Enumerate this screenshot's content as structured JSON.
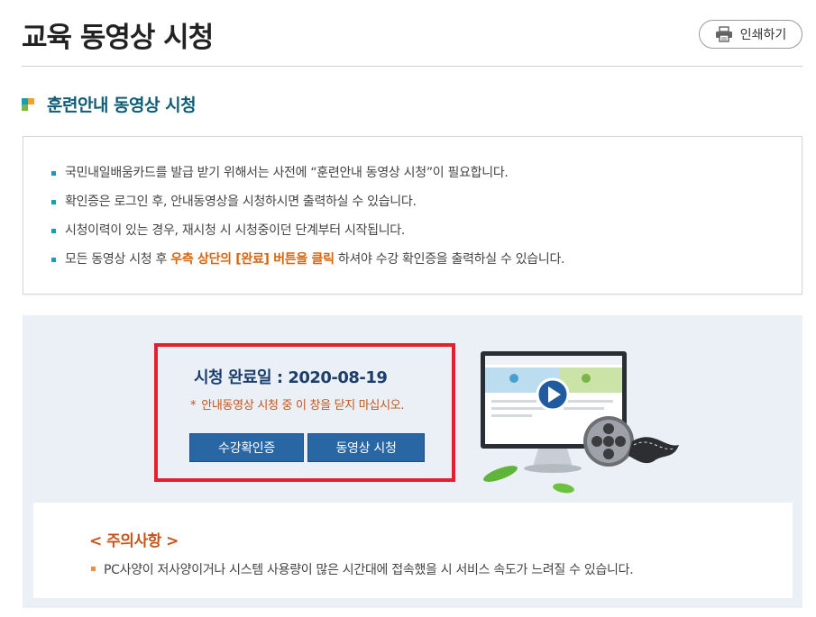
{
  "page": {
    "title": "교육 동영상 시청"
  },
  "toolbar": {
    "print_label": "인쇄하기",
    "print_icon": "printer-icon"
  },
  "section": {
    "heading": "훈련안내 동영상 시청",
    "icon": "square-bullet-icon"
  },
  "notices": [
    {
      "text": "국민내일배움카드를 발급 받기 위해서는 사전에 “훈련안내 동영상 시청”이 필요합니다."
    },
    {
      "text": "확인증은 로그인 후, 안내동영상을 시청하시면 출력하실 수 있습니다."
    },
    {
      "text": "시청이력이 있는 경우, 재시청 시 시청중이던 단계부터 시작됩니다."
    },
    {
      "before": "모든 동영상 시청 후 ",
      "highlight": "우측 상단의 [완료] 버튼을 클릭",
      "after": " 하셔야 수강 확인증을 출력하실 수 있습니다."
    }
  ],
  "video": {
    "complete_label": "시청 완료일 : ",
    "complete_date": "2020-08-19",
    "warning_star": "*",
    "warning_text": "안내동영상 시청 중 이 창을 닫지 마십시오.",
    "cert_button": "수강확인증",
    "play_button": "동영상 시청",
    "illustration_icon": "monitor-film-reel-icon"
  },
  "caution": {
    "title": "< 주의사항 >",
    "item": "PC사양이 저사양이거나 시스템 사용량이 많은 시간대에 접속했을 시 서비스 속도가 느려질 수 있습니다."
  },
  "colors": {
    "heading_teal": "#0e5d74",
    "highlight_orange": "#d2660e",
    "button_blue": "#2966a4",
    "frame_red": "#e4202f",
    "panel_bg": "#eaf0f6"
  }
}
